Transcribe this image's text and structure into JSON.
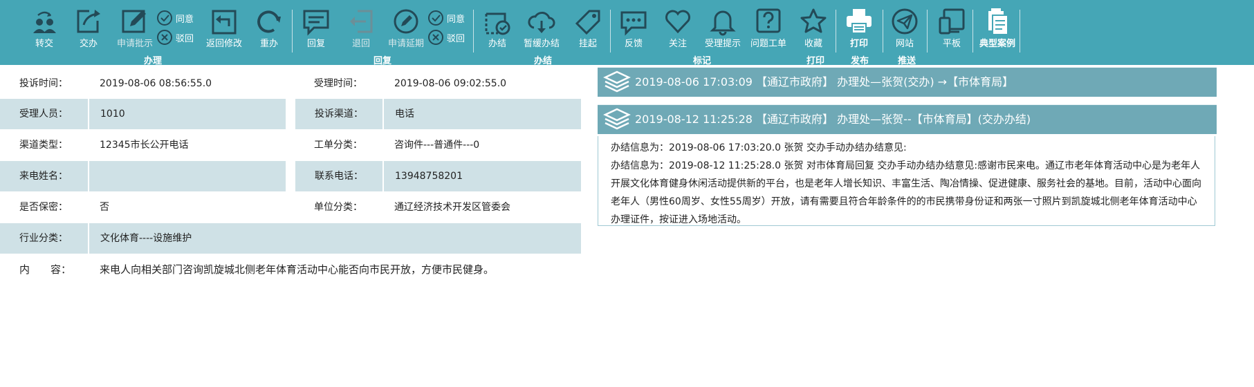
{
  "toolbar": {
    "buttons": {
      "transfer": "转交",
      "assign": "交办",
      "request_approval": "申请批示",
      "return_modify": "返回修改",
      "redo": "重办",
      "reply": "回复",
      "retreat": "退回",
      "request_extension": "申请延期",
      "complete": "办结",
      "defer_complete": "暂缓办结",
      "hang": "挂起",
      "feedback": "反馈",
      "follow": "关注",
      "accept_hint": "受理提示",
      "problem_order": "问题工单",
      "favorite": "收藏",
      "print": "打印",
      "website": "网站",
      "tablet": "平板",
      "typical_case": "典型案例"
    },
    "mini": {
      "agree_1": "同意",
      "reject_1": "驳回",
      "agree_2": "同意",
      "reject_2": "驳回"
    },
    "groups": {
      "handle": "办理",
      "reply": "回复",
      "complete": "办结",
      "mark": "标记",
      "print": "打印",
      "publish": "发布",
      "push": "推送"
    }
  },
  "info": {
    "complaint_time_label": "投诉时间：",
    "complaint_time": "2019-08-06 08:56:55.0",
    "accept_time_label": "受理时间：",
    "accept_time": "2019-08-06 09:02:55.0",
    "handler_label": "受理人员：",
    "handler": "1010",
    "channel_label": "投诉渠道：",
    "channel": "电话",
    "channel_type_label": "渠道类型：",
    "channel_type": "12345市长公开电话",
    "order_category_label": "工单分类：",
    "order_category": "咨询件---普通件---0",
    "caller_name_label": "来电姓名：",
    "caller_name": "",
    "phone_label": "联系电话：",
    "phone": "13948758201",
    "confidential_label": "是否保密：",
    "confidential": "否",
    "unit_category_label": "单位分类：",
    "unit_category": "通辽经济技术开发区管委会",
    "industry_label": "行业分类：",
    "industry": "文化体育----设施维护",
    "content_label": "内　　容：",
    "content": "来电人向相关部门咨询凯旋城北侧老年体育活动中心能否向市民开放，方便市民健身。"
  },
  "history": [
    {
      "text": "2019-08-06 17:03:09 【通辽市政府】 办理处—张贺(交办) →【市体育局】"
    },
    {
      "text": "2019-08-12 11:25:28 【通辽市政府】 办理处—张贺--【市体育局】(交办办结)"
    }
  ],
  "detail": {
    "line1": "办结信息为：2019-08-06 17:03:20.0  张贺    交办手动办结办结意见:",
    "line2": "办结信息为：2019-08-12 11:25:28.0  张贺  对市体育局回复  交办手动办结办结意见:感谢市民来电。通辽市老年体育活动中心是为老年人开展文化体育健身休闲活动提供新的平台，也是老年人增长知识、丰富生活、陶冶情操、促进健康、服务社会的基地。目前，活动中心面向老年人（男性60周岁、女性55周岁）开放，请有需要且符合年龄条件的的市民携带身份证和两张一寸照片到凯旋城北侧老年体育活动中心办理证件，按证进入场地活动。"
  },
  "colors": {
    "toolbar_bg": "#45a6b6",
    "icon_dark": "#234a57",
    "row_shade": "#cfe1e6",
    "history_bar": "#6fa9b6"
  }
}
